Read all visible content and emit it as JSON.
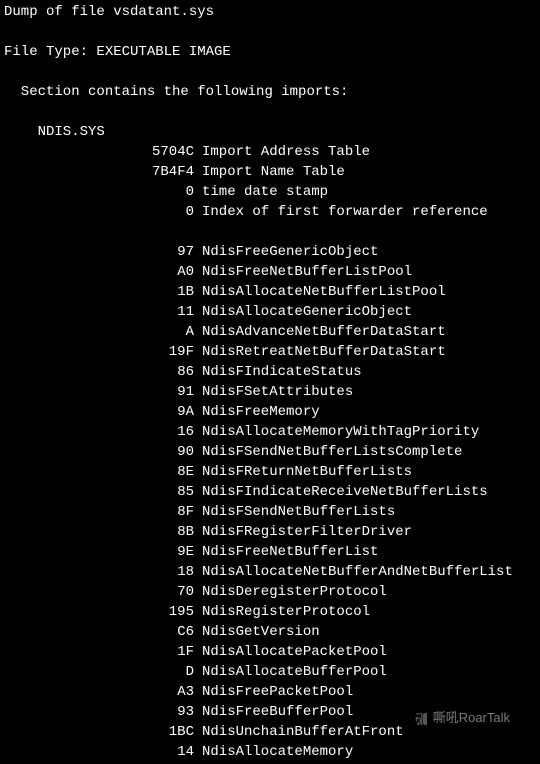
{
  "header": {
    "dump_line": "Dump of file vsdatant.sys",
    "file_type_line": "File Type: EXECUTABLE IMAGE",
    "section_line": "  Section contains the following imports:",
    "module_name": "    NDIS.SYS"
  },
  "table_meta": [
    {
      "addr": "5704C",
      "label": "Import Address Table"
    },
    {
      "addr": "7B4F4",
      "label": "Import Name Table"
    },
    {
      "addr": "0",
      "label": "time date stamp"
    },
    {
      "addr": "0",
      "label": "Index of first forwarder reference"
    }
  ],
  "imports": [
    {
      "ord": "97",
      "name": "NdisFreeGenericObject"
    },
    {
      "ord": "A0",
      "name": "NdisFreeNetBufferListPool"
    },
    {
      "ord": "1B",
      "name": "NdisAllocateNetBufferListPool"
    },
    {
      "ord": "11",
      "name": "NdisAllocateGenericObject"
    },
    {
      "ord": "A",
      "name": "NdisAdvanceNetBufferDataStart"
    },
    {
      "ord": "19F",
      "name": "NdisRetreatNetBufferDataStart"
    },
    {
      "ord": "86",
      "name": "NdisFIndicateStatus"
    },
    {
      "ord": "91",
      "name": "NdisFSetAttributes"
    },
    {
      "ord": "9A",
      "name": "NdisFreeMemory"
    },
    {
      "ord": "16",
      "name": "NdisAllocateMemoryWithTagPriority"
    },
    {
      "ord": "90",
      "name": "NdisFSendNetBufferListsComplete"
    },
    {
      "ord": "8E",
      "name": "NdisFReturnNetBufferLists"
    },
    {
      "ord": "85",
      "name": "NdisFIndicateReceiveNetBufferLists"
    },
    {
      "ord": "8F",
      "name": "NdisFSendNetBufferLists"
    },
    {
      "ord": "8B",
      "name": "NdisFRegisterFilterDriver"
    },
    {
      "ord": "9E",
      "name": "NdisFreeNetBufferList"
    },
    {
      "ord": "18",
      "name": "NdisAllocateNetBufferAndNetBufferList"
    },
    {
      "ord": "70",
      "name": "NdisDeregisterProtocol"
    },
    {
      "ord": "195",
      "name": "NdisRegisterProtocol"
    },
    {
      "ord": "C6",
      "name": "NdisGetVersion"
    },
    {
      "ord": "1F",
      "name": "NdisAllocatePacketPool"
    },
    {
      "ord": "D",
      "name": "NdisAllocateBufferPool"
    },
    {
      "ord": "A3",
      "name": "NdisFreePacketPool"
    },
    {
      "ord": "93",
      "name": "NdisFreeBufferPool"
    },
    {
      "ord": "1BC",
      "name": "NdisUnchainBufferAtFront"
    },
    {
      "ord": "14",
      "name": "NdisAllocateMemory"
    }
  ],
  "watermark": "嘶吼RoarTalk"
}
